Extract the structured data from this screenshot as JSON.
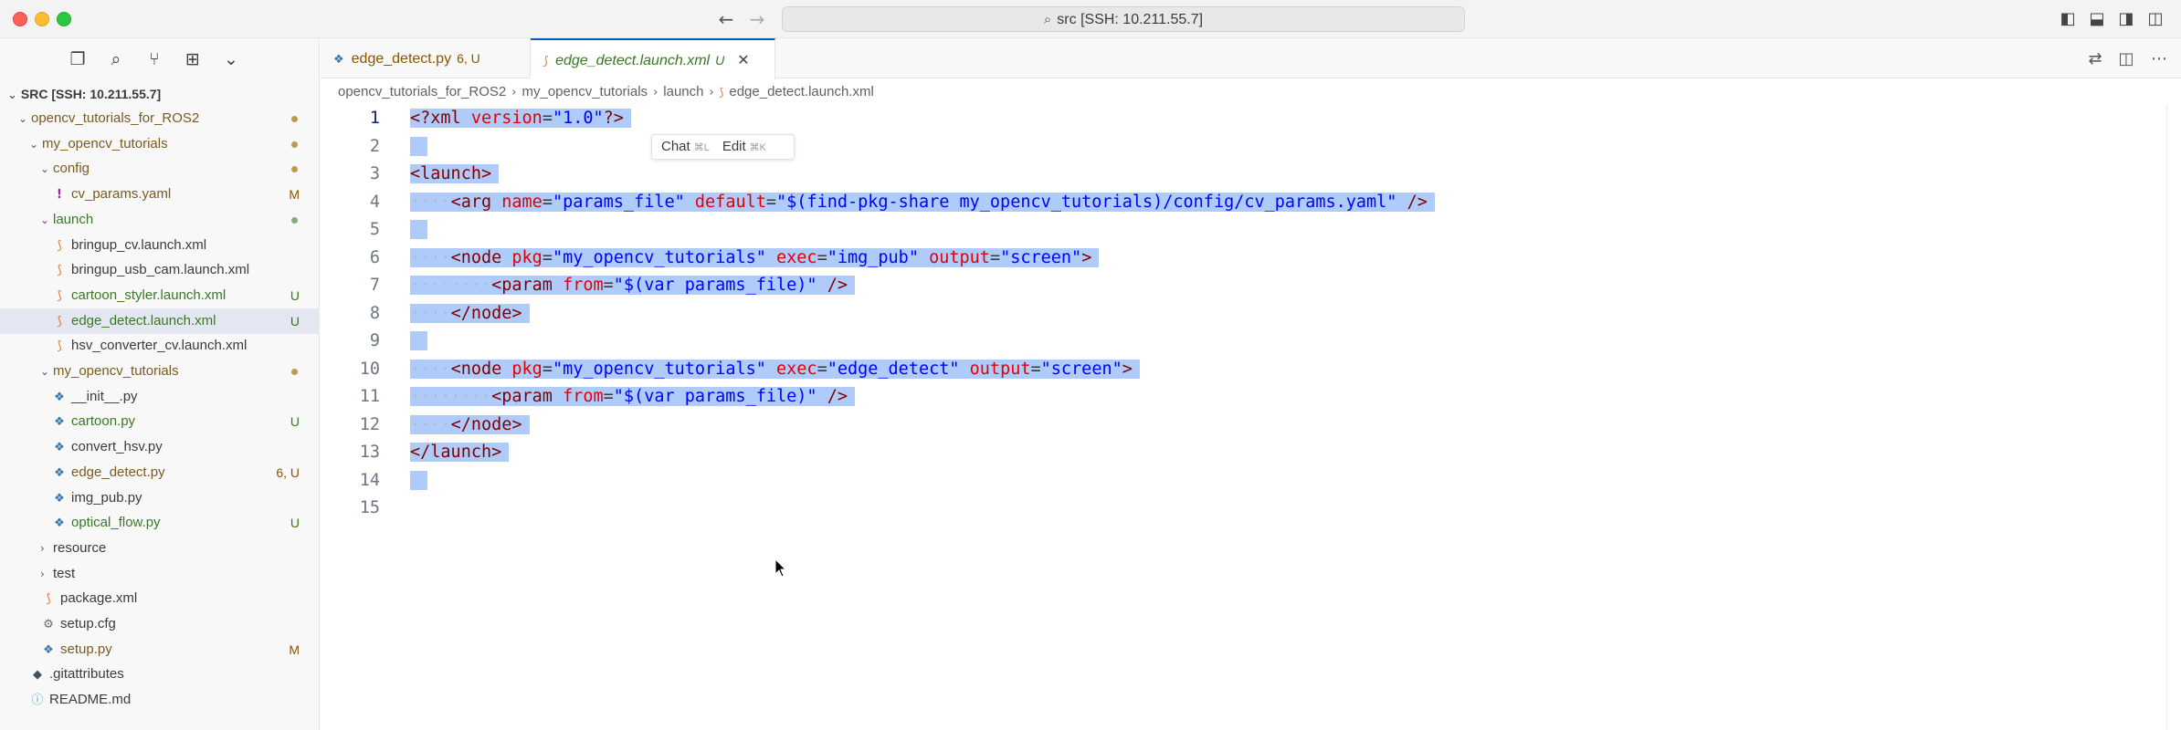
{
  "window": {
    "command_center": "src [SSH: 10.211.55.7]"
  },
  "sidebar": {
    "root_label": "SRC [SSH: 10.211.55.7]",
    "tree": [
      {
        "label": "opencv_tutorials_for_ROS2",
        "depth": 1,
        "kind": "folder",
        "open": true,
        "status": "dot-gold",
        "color": "gold"
      },
      {
        "label": "my_opencv_tutorials",
        "depth": 2,
        "kind": "folder",
        "open": true,
        "status": "dot-gold",
        "color": "gold"
      },
      {
        "label": "config",
        "depth": 3,
        "kind": "folder",
        "open": true,
        "status": "dot-gold",
        "color": "gold"
      },
      {
        "label": "cv_params.yaml",
        "depth": 4,
        "kind": "yaml",
        "status": "M",
        "color": "gold"
      },
      {
        "label": "launch",
        "depth": 3,
        "kind": "folder",
        "open": true,
        "status": "dot-green",
        "color": "green"
      },
      {
        "label": "bringup_cv.launch.xml",
        "depth": 4,
        "kind": "xml",
        "status": "",
        "color": ""
      },
      {
        "label": "bringup_usb_cam.launch.xml",
        "depth": 4,
        "kind": "xml",
        "status": "",
        "color": ""
      },
      {
        "label": "cartoon_styler.launch.xml",
        "depth": 4,
        "kind": "xml",
        "status": "U",
        "color": "green"
      },
      {
        "label": "edge_detect.launch.xml",
        "depth": 4,
        "kind": "xml",
        "status": "U",
        "color": "green",
        "selected": true
      },
      {
        "label": "hsv_converter_cv.launch.xml",
        "depth": 4,
        "kind": "xml",
        "status": "",
        "color": ""
      },
      {
        "label": "my_opencv_tutorials",
        "depth": 3,
        "kind": "folder",
        "open": true,
        "status": "dot-gold",
        "color": "gold"
      },
      {
        "label": "__init__.py",
        "depth": 4,
        "kind": "py",
        "status": "",
        "color": ""
      },
      {
        "label": "cartoon.py",
        "depth": 4,
        "kind": "py",
        "status": "U",
        "color": "green"
      },
      {
        "label": "convert_hsv.py",
        "depth": 4,
        "kind": "py",
        "status": "",
        "color": ""
      },
      {
        "label": "edge_detect.py",
        "depth": 4,
        "kind": "py",
        "status": "6, U",
        "color": "gold"
      },
      {
        "label": "img_pub.py",
        "depth": 4,
        "kind": "py",
        "status": "",
        "color": ""
      },
      {
        "label": "optical_flow.py",
        "depth": 4,
        "kind": "py",
        "status": "U",
        "color": "green"
      },
      {
        "label": "resource",
        "depth": 3,
        "kind": "folder",
        "open": false,
        "status": "",
        "color": ""
      },
      {
        "label": "test",
        "depth": 3,
        "kind": "folder",
        "open": false,
        "status": "",
        "color": ""
      },
      {
        "label": "package.xml",
        "depth": 3,
        "kind": "xml",
        "status": "",
        "color": ""
      },
      {
        "label": "setup.cfg",
        "depth": 3,
        "kind": "cfg",
        "status": "",
        "color": ""
      },
      {
        "label": "setup.py",
        "depth": 3,
        "kind": "py",
        "status": "M",
        "color": "gold"
      },
      {
        "label": ".gitattributes",
        "depth": 2,
        "kind": "git",
        "status": "",
        "color": ""
      },
      {
        "label": "README.md",
        "depth": 2,
        "kind": "info",
        "status": "",
        "color": ""
      }
    ]
  },
  "tabs": [
    {
      "label": "edge_detect.py",
      "status": "6, U"
    },
    {
      "label": "edge_detect.launch.xml",
      "status": "U"
    }
  ],
  "breadcrumb": [
    "opencv_tutorials_for_ROS2",
    "my_opencv_tutorials",
    "launch",
    "edge_detect.launch.xml"
  ],
  "inline_hint": {
    "chat": "Chat",
    "chat_key": "⌘L",
    "edit": "Edit",
    "edit_key": "⌘K"
  },
  "code_lines": [
    {
      "n": "1",
      "text": "<?xml version=\"1.0\"?>"
    },
    {
      "n": "2",
      "text": ""
    },
    {
      "n": "3",
      "text": "<launch>"
    },
    {
      "n": "4",
      "text": "    <arg name=\"params_file\" default=\"$(find-pkg-share my_opencv_tutorials)/config/cv_params.yaml\" />"
    },
    {
      "n": "5",
      "text": ""
    },
    {
      "n": "6",
      "text": "    <node pkg=\"my_opencv_tutorials\" exec=\"img_pub\" output=\"screen\">"
    },
    {
      "n": "7",
      "text": "        <param from=\"$(var params_file)\" />"
    },
    {
      "n": "8",
      "text": "    </node>"
    },
    {
      "n": "9",
      "text": ""
    },
    {
      "n": "10",
      "text": "    <node pkg=\"my_opencv_tutorials\" exec=\"edge_detect\" output=\"screen\">"
    },
    {
      "n": "11",
      "text": "        <param from=\"$(var params_file)\" />"
    },
    {
      "n": "12",
      "text": "    </node>"
    },
    {
      "n": "13",
      "text": "</launch>"
    },
    {
      "n": "14",
      "text": ""
    },
    {
      "n": "15",
      "text": ""
    }
  ]
}
